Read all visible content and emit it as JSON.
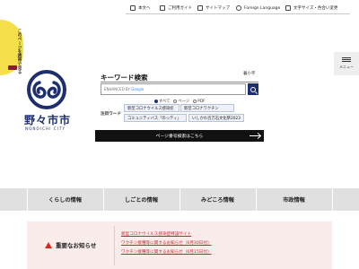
{
  "utility": {
    "items": [
      {
        "label": "本文へ",
        "icon": "text-icon"
      },
      {
        "label": "ご利用ガイド",
        "icon": "guide-icon"
      },
      {
        "label": "サイトマップ",
        "icon": "sitemap-icon"
      },
      {
        "label": "Foreign Language",
        "icon": "globe-icon"
      },
      {
        "label": "文字サイズ・色合い変更",
        "icon": "display-icon"
      }
    ]
  },
  "mobile_badge": {
    "text": "このページを携帯で見る"
  },
  "logo": {
    "city_name": "野々市市",
    "romaji": "NONOICHI CITY"
  },
  "search": {
    "title": "キーワード検索",
    "corner_label": "暮小字",
    "brand_prefix": "ENHANCED BY",
    "brand_name": "Google",
    "scope_options": [
      "すべて",
      "ページ",
      "PDF"
    ],
    "selected_scope": "すべて",
    "hot_words_label": "注目ワード",
    "hot_words": [
      "新型コロナウイルス感染症",
      "新型コロナワクチン",
      "コミュニティバス「のっティ」",
      "いしかわ百万石文化祭2023"
    ],
    "page_search_label": "ページ番号検索はこちら"
  },
  "menu": {
    "label": "メニュー"
  },
  "gnav": {
    "items": [
      "くらしの情報",
      "しごとの情報",
      "みどころ情報",
      "市政情報"
    ]
  },
  "notice": {
    "title": "重要なお知らせ",
    "links": [
      "新型コロナウイルス感染症特設サイト",
      "ワクチン接種等に関するお知らせ（6月30日付）",
      "ワクチン接種等に関するお知らせ（6月15日付）"
    ]
  },
  "colors": {
    "brand": "#1e2f6f",
    "alert": "#d6281e",
    "mobile_badge": "#f6e04a"
  }
}
